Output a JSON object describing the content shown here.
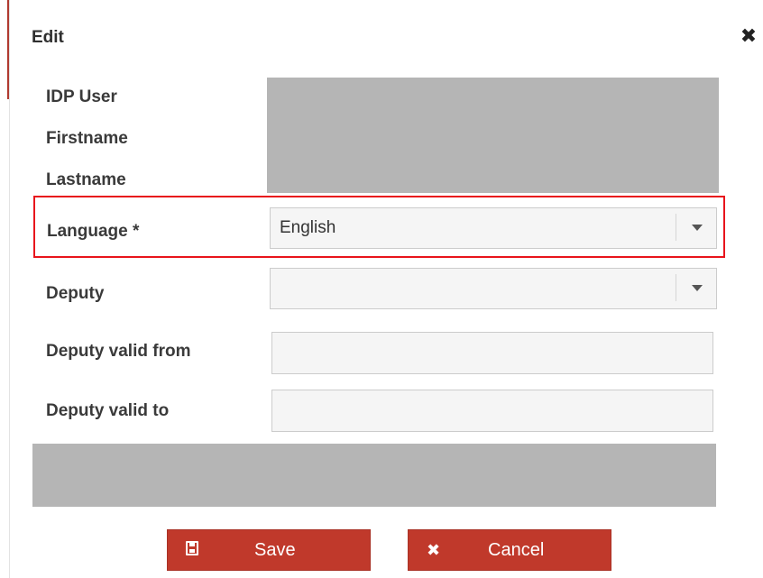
{
  "dialog": {
    "title": "Edit",
    "close_icon": "close-icon"
  },
  "fields": {
    "idp_user_label": "IDP User",
    "firstname_label": "Firstname",
    "lastname_label": "Lastname",
    "language_label": "Language *",
    "language_value": "English",
    "deputy_label": "Deputy",
    "deputy_value": "",
    "deputy_valid_from_label": "Deputy valid from",
    "deputy_valid_from_value": "",
    "deputy_valid_to_label": "Deputy valid to",
    "deputy_valid_to_value": ""
  },
  "buttons": {
    "save_label": "Save",
    "cancel_label": "Cancel"
  },
  "colors": {
    "highlight": "#e8141c",
    "button": "#c0392b",
    "redacted": "#b5b5b5"
  }
}
